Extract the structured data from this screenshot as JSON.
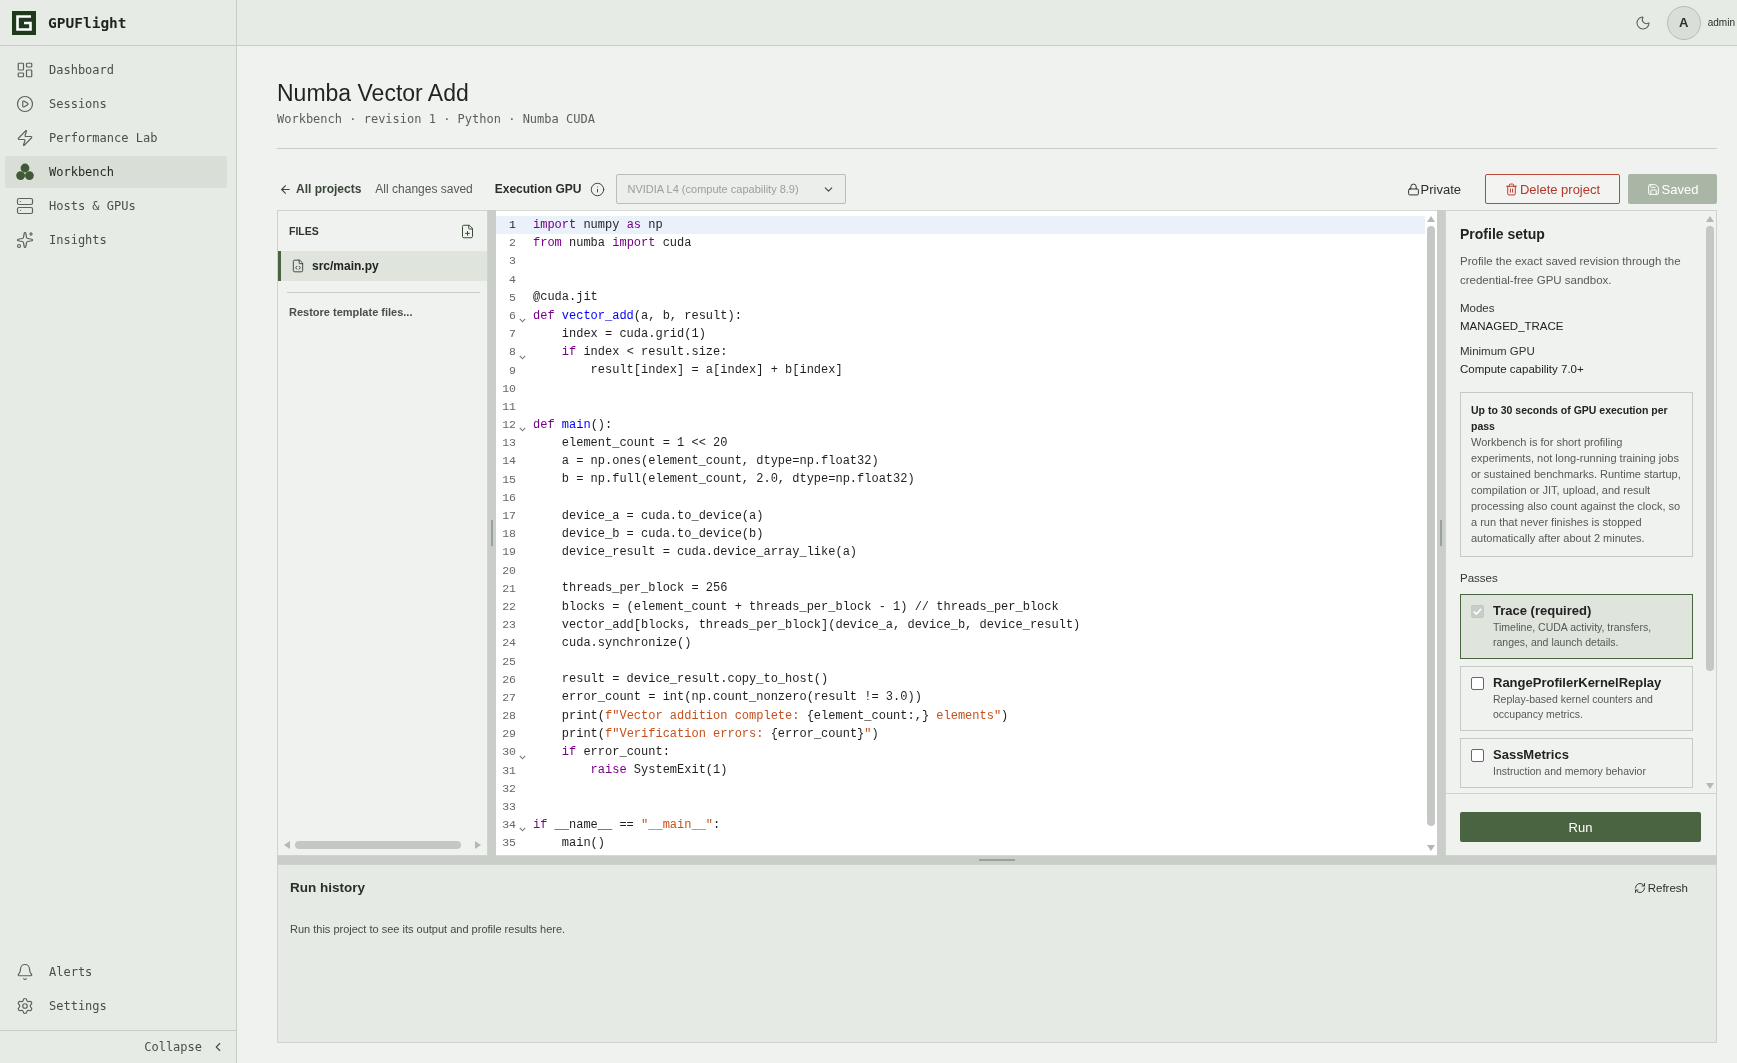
{
  "app": {
    "name": "GPUFlight"
  },
  "sidebar": {
    "items": [
      {
        "label": "Dashboard",
        "selected": false
      },
      {
        "label": "Sessions",
        "selected": false
      },
      {
        "label": "Performance Lab",
        "selected": false
      },
      {
        "label": "Workbench",
        "selected": true
      },
      {
        "label": "Hosts & GPUs",
        "selected": false
      },
      {
        "label": "Insights",
        "selected": false
      }
    ],
    "bottom_items": [
      {
        "label": "Alerts",
        "selected": false
      },
      {
        "label": "Settings",
        "selected": false
      }
    ],
    "collapse": "Collapse"
  },
  "header": {
    "user": {
      "initial": "A",
      "name": "admin"
    }
  },
  "page": {
    "title": "Numba Vector Add",
    "subtitle": "Workbench · revision 1 · Python · Numba CUDA"
  },
  "toolbar": {
    "back_link": "All projects",
    "save_status": "All changes saved",
    "gpu_label": "Execution GPU",
    "gpu_select": {
      "value": "NVIDIA L4 (compute capability 8.9)",
      "disabled": true
    },
    "visibility": "Private",
    "delete_button": "Delete project",
    "save_button": {
      "label": "Saved",
      "disabled": true
    }
  },
  "files": {
    "title": "FILES",
    "items": [
      {
        "name": "src/main.py",
        "selected": true
      }
    ],
    "restore_link": "Restore template files..."
  },
  "code": {
    "lines": [
      {
        "number": "1",
        "active": true,
        "foldable": false,
        "tokens": [
          {
            "kind": "keyword",
            "text": "import"
          },
          {
            "kind": "plain",
            "text": " numpy "
          },
          {
            "kind": "keyword",
            "text": "as"
          },
          {
            "kind": "plain",
            "text": " np"
          }
        ]
      },
      {
        "number": "2",
        "active": false,
        "foldable": false,
        "tokens": [
          {
            "kind": "keyword",
            "text": "from"
          },
          {
            "kind": "plain",
            "text": " numba "
          },
          {
            "kind": "keyword",
            "text": "import"
          },
          {
            "kind": "plain",
            "text": " cuda"
          }
        ]
      },
      {
        "number": "3",
        "active": false,
        "foldable": false
      },
      {
        "number": "4",
        "active": false,
        "foldable": false
      },
      {
        "number": "5",
        "active": false,
        "foldable": false,
        "tokens": [
          {
            "kind": "plain",
            "text": "@cuda.jit"
          }
        ]
      },
      {
        "number": "6",
        "active": false,
        "foldable": true,
        "tokens": [
          {
            "kind": "keyword",
            "text": "def"
          },
          {
            "kind": "function",
            "text": " vector_add"
          },
          {
            "kind": "plain",
            "text": "(a, b, result):"
          }
        ]
      },
      {
        "number": "7",
        "active": false,
        "foldable": false,
        "tokens": [
          {
            "kind": "plain",
            "text": "    index = cuda.grid(1)"
          }
        ]
      },
      {
        "number": "8",
        "active": false,
        "foldable": true,
        "tokens": [
          {
            "kind": "keyword",
            "text": "    if"
          },
          {
            "kind": "plain",
            "text": " index < result.size:"
          }
        ]
      },
      {
        "number": "9",
        "active": false,
        "foldable": false,
        "tokens": [
          {
            "kind": "plain",
            "text": "        result[index] = a[index] + b[index]"
          }
        ]
      },
      {
        "number": "10",
        "active": false,
        "foldable": false
      },
      {
        "number": "11",
        "active": false,
        "foldable": false
      },
      {
        "number": "12",
        "active": false,
        "foldable": true,
        "tokens": [
          {
            "kind": "keyword",
            "text": "def"
          },
          {
            "kind": "function",
            "text": " main"
          },
          {
            "kind": "plain",
            "text": "():"
          }
        ]
      },
      {
        "number": "13",
        "active": false,
        "foldable": false,
        "tokens": [
          {
            "kind": "plain",
            "text": "    element_count = 1 << 20"
          }
        ]
      },
      {
        "number": "14",
        "active": false,
        "foldable": false,
        "tokens": [
          {
            "kind": "plain",
            "text": "    a = np.ones(element_count, dtype=np.float32)"
          }
        ]
      },
      {
        "number": "15",
        "active": false,
        "foldable": false,
        "tokens": [
          {
            "kind": "plain",
            "text": "    b = np.full(element_count, 2.0, dtype=np.float32)"
          }
        ]
      },
      {
        "number": "16",
        "active": false,
        "foldable": false
      },
      {
        "number": "17",
        "active": false,
        "foldable": false,
        "tokens": [
          {
            "kind": "plain",
            "text": "    device_a = cuda.to_device(a)"
          }
        ]
      },
      {
        "number": "18",
        "active": false,
        "foldable": false,
        "tokens": [
          {
            "kind": "plain",
            "text": "    device_b = cuda.to_device(b)"
          }
        ]
      },
      {
        "number": "19",
        "active": false,
        "foldable": false,
        "tokens": [
          {
            "kind": "plain",
            "text": "    device_result = cuda.device_array_like(a)"
          }
        ]
      },
      {
        "number": "20",
        "active": false,
        "foldable": false
      },
      {
        "number": "21",
        "active": false,
        "foldable": false,
        "tokens": [
          {
            "kind": "plain",
            "text": "    threads_per_block = 256"
          }
        ]
      },
      {
        "number": "22",
        "active": false,
        "foldable": false,
        "tokens": [
          {
            "kind": "plain",
            "text": "    blocks = (element_count + threads_per_block - 1) // threads_per_block"
          }
        ]
      },
      {
        "number": "23",
        "active": false,
        "foldable": false,
        "tokens": [
          {
            "kind": "plain",
            "text": "    vector_add[blocks, threads_per_block](device_a, device_b, device_result)"
          }
        ]
      },
      {
        "number": "24",
        "active": false,
        "foldable": false,
        "tokens": [
          {
            "kind": "plain",
            "text": "    cuda.synchronize()"
          }
        ]
      },
      {
        "number": "25",
        "active": false,
        "foldable": false
      },
      {
        "number": "26",
        "active": false,
        "foldable": false,
        "tokens": [
          {
            "kind": "plain",
            "text": "    result = device_result.copy_to_host()"
          }
        ]
      },
      {
        "number": "27",
        "active": false,
        "foldable": false,
        "tokens": [
          {
            "kind": "plain",
            "text": "    error_count = int(np.count_nonzero(result != 3.0))"
          }
        ]
      },
      {
        "number": "28",
        "active": false,
        "foldable": false,
        "tokens": [
          {
            "kind": "plain",
            "text": "    print("
          },
          {
            "kind": "string",
            "text": "f\"Vector addition complete: "
          },
          {
            "kind": "plain",
            "text": "{element_count:,}"
          },
          {
            "kind": "string",
            "text": " elements\""
          },
          {
            "kind": "plain",
            "text": ")"
          }
        ]
      },
      {
        "number": "29",
        "active": false,
        "foldable": false,
        "tokens": [
          {
            "kind": "plain",
            "text": "    print("
          },
          {
            "kind": "string",
            "text": "f\"Verification errors: "
          },
          {
            "kind": "plain",
            "text": "{error_count}"
          },
          {
            "kind": "string",
            "text": "\""
          },
          {
            "kind": "plain",
            "text": ")"
          }
        ]
      },
      {
        "number": "30",
        "active": false,
        "foldable": true,
        "tokens": [
          {
            "kind": "keyword",
            "text": "    if"
          },
          {
            "kind": "plain",
            "text": " error_count:"
          }
        ]
      },
      {
        "number": "31",
        "active": false,
        "foldable": false,
        "tokens": [
          {
            "kind": "keyword",
            "text": "        raise"
          },
          {
            "kind": "plain",
            "text": " SystemExit(1)"
          }
        ]
      },
      {
        "number": "32",
        "active": false,
        "foldable": false
      },
      {
        "number": "33",
        "active": false,
        "foldable": false
      },
      {
        "number": "34",
        "active": false,
        "foldable": true,
        "tokens": [
          {
            "kind": "keyword",
            "text": "if"
          },
          {
            "kind": "plain",
            "text": " __name__ == "
          },
          {
            "kind": "string",
            "text": "\"__main__\""
          },
          {
            "kind": "plain",
            "text": ":"
          }
        ]
      },
      {
        "number": "35",
        "active": false,
        "foldable": false,
        "tokens": [
          {
            "kind": "plain",
            "text": "    main()"
          }
        ]
      }
    ]
  },
  "profile": {
    "title": "Profile setup",
    "description": "Profile the exact saved revision through the credential-free GPU sandbox.",
    "fields": [
      {
        "label": "Modes",
        "value": "MANAGED_TRACE"
      },
      {
        "label": "Minimum GPU",
        "value": "Compute capability 7.0+"
      }
    ],
    "notice": {
      "title": "Up to 30 seconds of GPU execution per pass",
      "body": "Workbench is for short profiling experiments, not long-running training jobs or sustained benchmarks. Runtime startup, compilation or JIT, upload, and result processing also count against the clock, so a run that never finishes is stopped automatically after about 2 minutes."
    },
    "passes_label": "Passes",
    "passes": [
      {
        "name": "Trace (required)",
        "description": "Timeline, CUDA activity, transfers, ranges, and launch details.",
        "checked": true,
        "disabled": true
      },
      {
        "name": "RangeProfilerKernelReplay",
        "description": "Replay-based kernel counters and occupancy metrics.",
        "checked": false,
        "disabled": false
      },
      {
        "name": "SassMetrics",
        "description": "Instruction and memory behavior",
        "checked": false,
        "disabled": false
      }
    ],
    "run_button": "Run"
  },
  "run_history": {
    "title": "Run history",
    "refresh": "Refresh",
    "empty_text": "Run this project to see its output and profile results here."
  }
}
